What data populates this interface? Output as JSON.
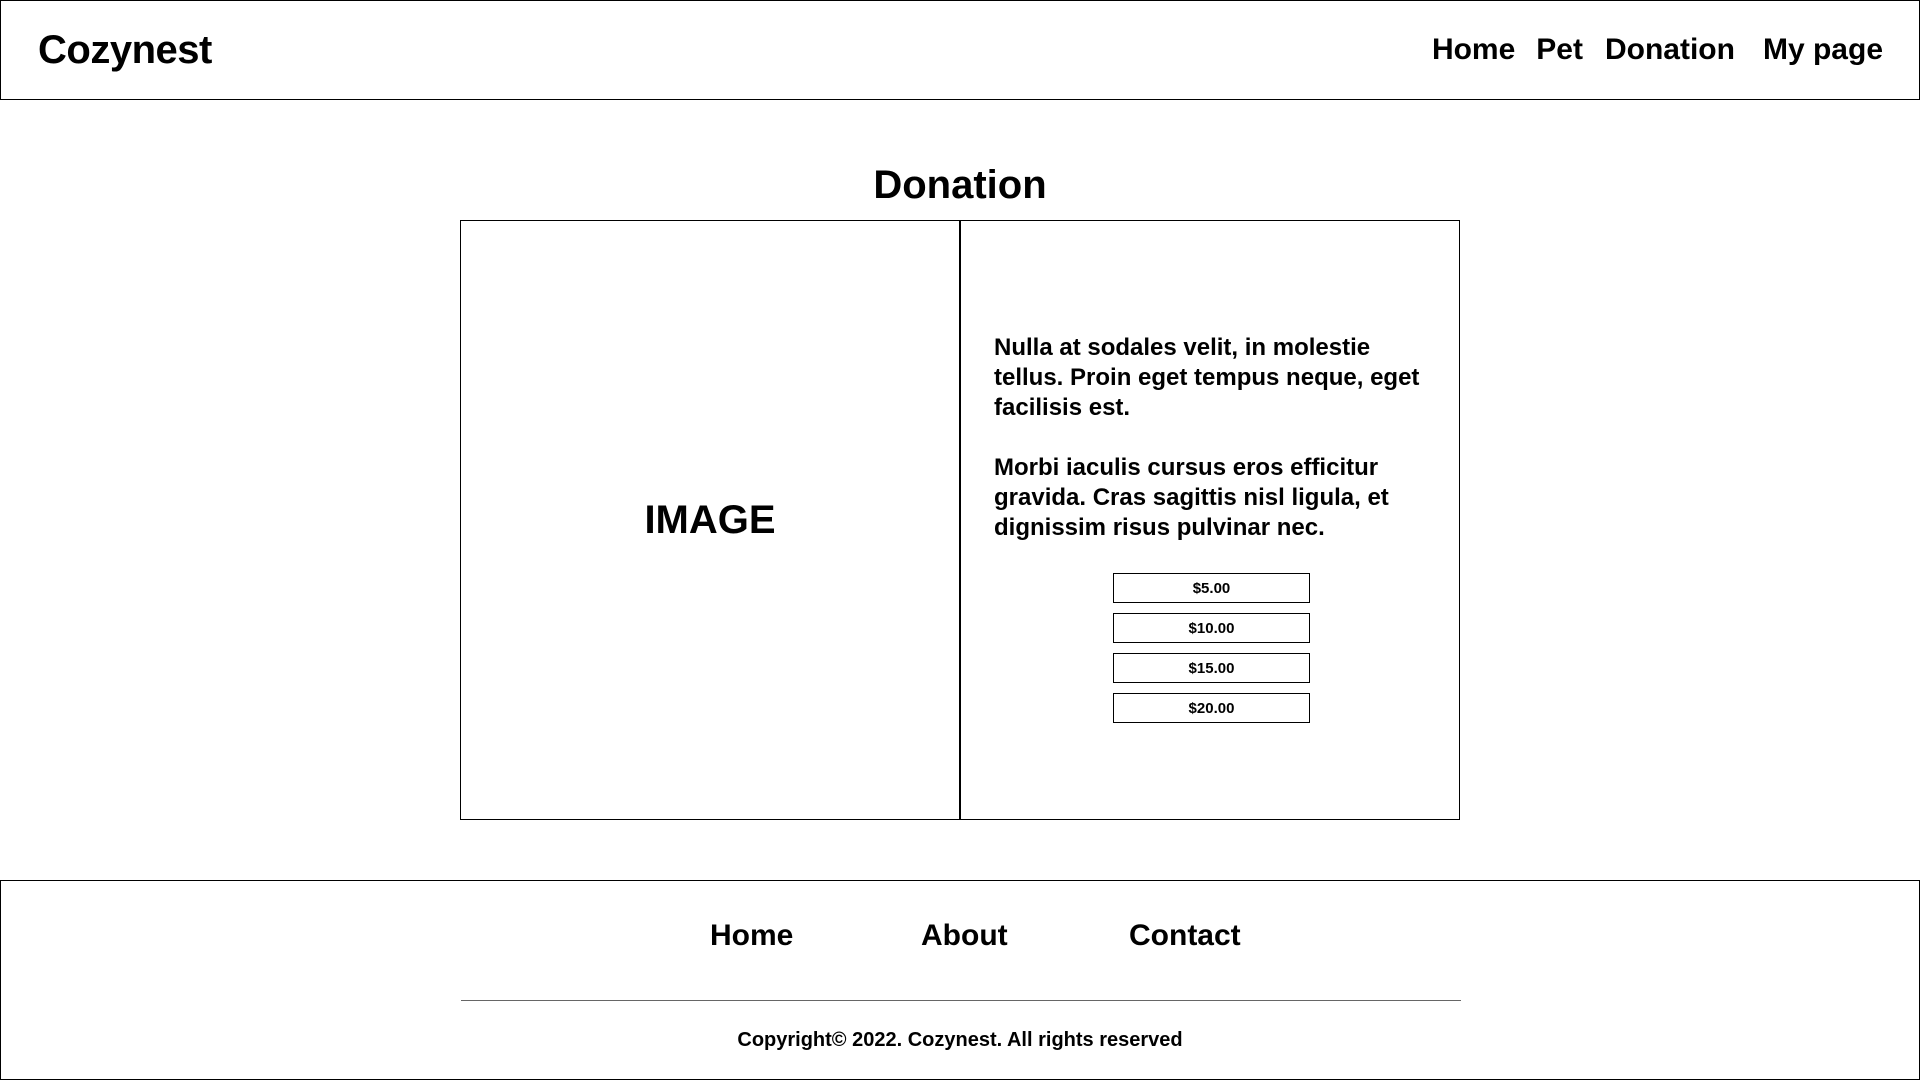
{
  "header": {
    "brand": "Cozynest",
    "nav": {
      "home": "Home",
      "pet": "Pet",
      "donation": "Donation",
      "my_page": "My page"
    }
  },
  "main": {
    "title": "Donation",
    "image_placeholder": "IMAGE",
    "paragraphs": [
      "Nulla at sodales velit, in molestie tellus. Proin eget tempus neque, eget facilisis est.",
      "Morbi iaculis cursus eros efficitur gravida. Cras sagittis nisl ligula, et dignissim risus pulvinar nec."
    ],
    "amounts": [
      "$5.00",
      "$10.00",
      "$15.00",
      "$20.00"
    ]
  },
  "footer": {
    "links": {
      "home": "Home",
      "about": "About",
      "contact": "Contact"
    },
    "copyright": "Copyright© 2022. Cozynest. All rights reserved"
  }
}
